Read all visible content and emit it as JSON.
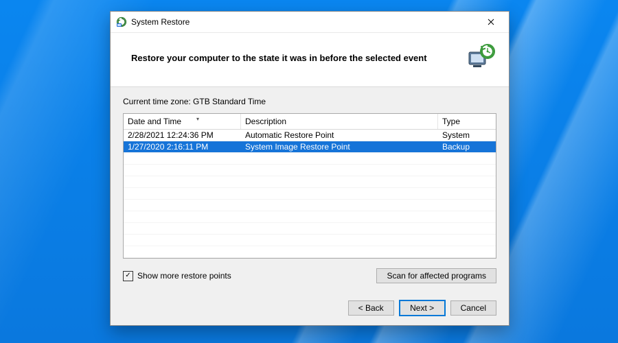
{
  "window": {
    "title": "System Restore"
  },
  "header": {
    "headline": "Restore your computer to the state it was in before the selected event"
  },
  "timezone_label": "Current time zone: GTB Standard Time",
  "columns": {
    "datetime": "Date and Time",
    "description": "Description",
    "type": "Type"
  },
  "rows": [
    {
      "datetime": "2/28/2021 12:24:36 PM",
      "description": "Automatic Restore Point",
      "type": "System",
      "selected": false
    },
    {
      "datetime": "1/27/2020 2:16:11 PM",
      "description": "System Image Restore Point",
      "type": "Backup",
      "selected": true
    }
  ],
  "show_more": {
    "checked": true,
    "label": "Show more restore points"
  },
  "buttons": {
    "scan": "Scan for affected programs",
    "back": "< Back",
    "next": "Next >",
    "cancel": "Cancel"
  }
}
